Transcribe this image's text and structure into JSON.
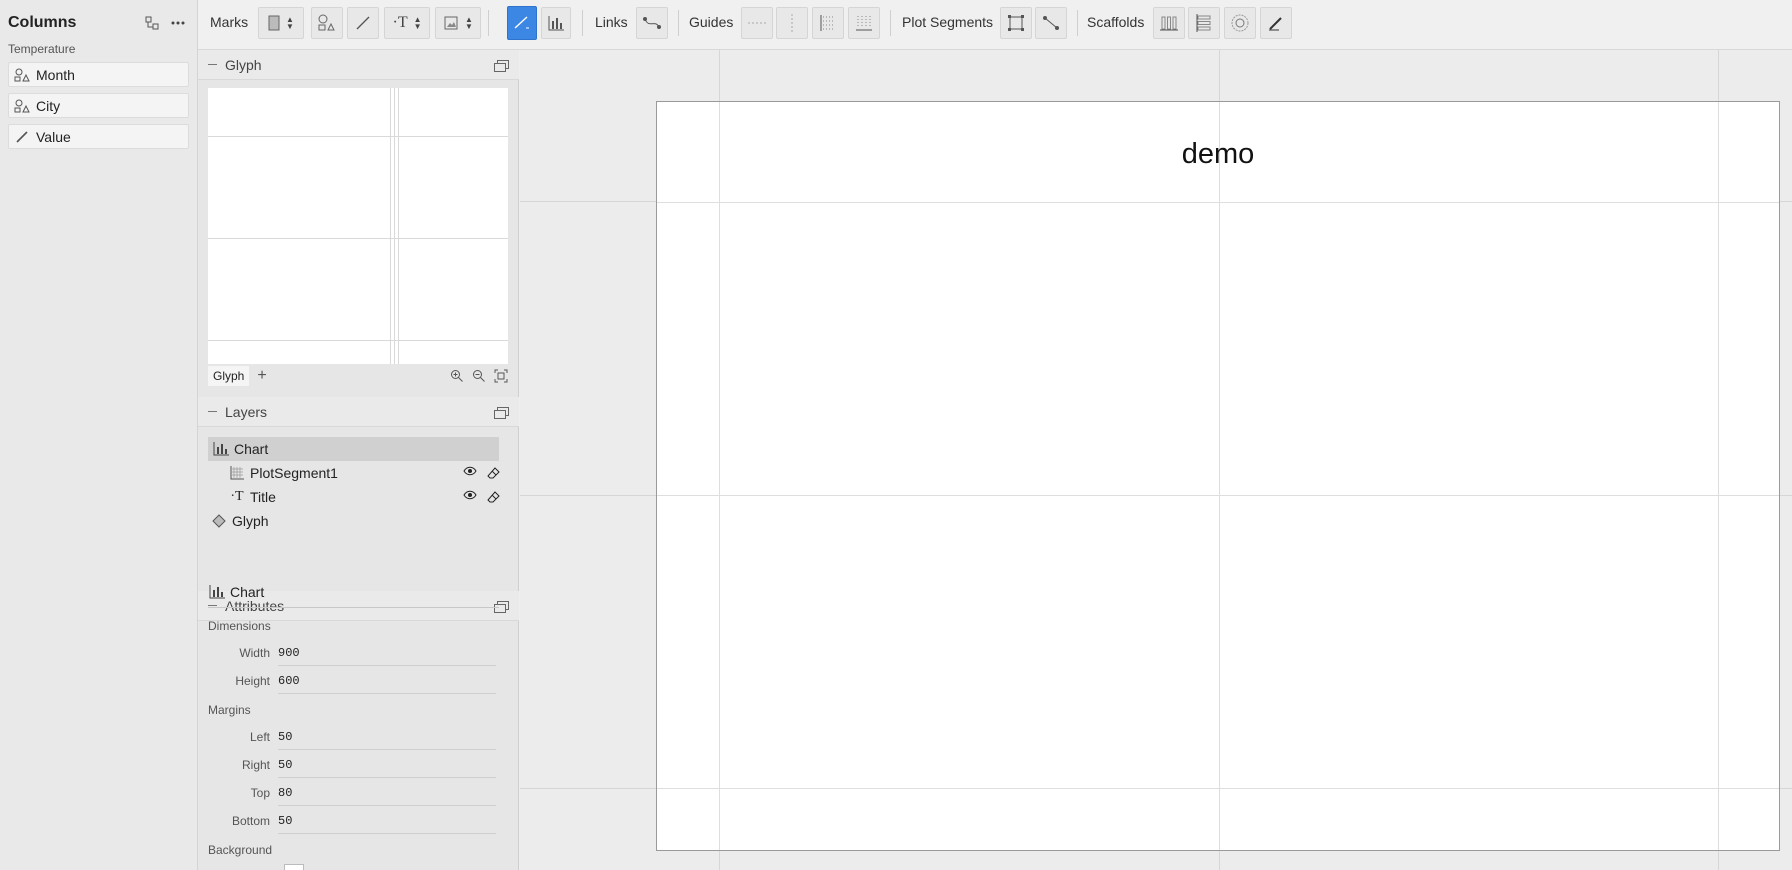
{
  "columns_panel": {
    "title": "Columns",
    "dataset": "Temperature",
    "items": [
      {
        "label": "Month",
        "icon": "categorical-icon"
      },
      {
        "label": "City",
        "icon": "categorical-icon"
      },
      {
        "label": "Value",
        "icon": "numerical-icon"
      }
    ]
  },
  "toolbar": {
    "marks_label": "Marks",
    "links_label": "Links",
    "guides_label": "Guides",
    "plot_segments_label": "Plot Segments",
    "scaffolds_label": "Scaffolds",
    "text_mark_glyph": "·T"
  },
  "glyph_section": {
    "title": "Glyph",
    "tab_label": "Glyph"
  },
  "layers_section": {
    "title": "Layers",
    "items": [
      {
        "label": "Chart"
      },
      {
        "label": "PlotSegment1"
      },
      {
        "label": "Title",
        "icon_text": "·T"
      },
      {
        "label": "Glyph"
      }
    ]
  },
  "attributes_section": {
    "title": "Attributes",
    "object": "Chart",
    "dimensions_label": "Dimensions",
    "width_label": "Width",
    "width_value": "900",
    "height_label": "Height",
    "height_value": "600",
    "margins_label": "Margins",
    "left_label": "Left",
    "left_value": "50",
    "right_label": "Right",
    "right_value": "50",
    "top_label": "Top",
    "top_value": "80",
    "bottom_label": "Bottom",
    "bottom_value": "50",
    "background_label": "Background"
  },
  "chart": {
    "title": "demo"
  },
  "colors": {
    "accent": "#3d87e4"
  }
}
